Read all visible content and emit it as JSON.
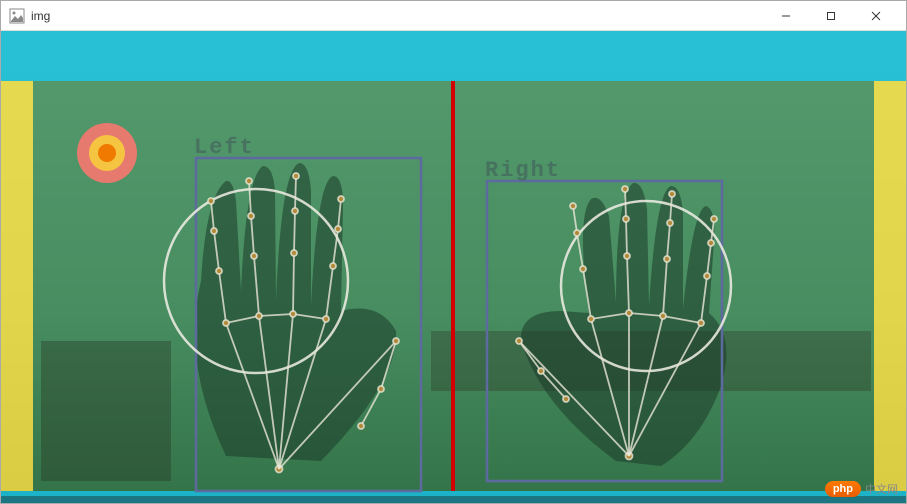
{
  "window": {
    "title": "img",
    "icon_name": "app-icon"
  },
  "labels": {
    "left_hand": "Left",
    "right_hand": "Right"
  },
  "watermark": {
    "pill": "php",
    "text": "中文网"
  },
  "overlay_colors": {
    "cyan": "#16C7E2",
    "yellow": "#F6E547",
    "green": "#2E9B5A",
    "red_divider": "#D40000",
    "marker_outer": "#E77A6F",
    "marker_mid": "#F5C542",
    "marker_inner": "#F07A00"
  }
}
